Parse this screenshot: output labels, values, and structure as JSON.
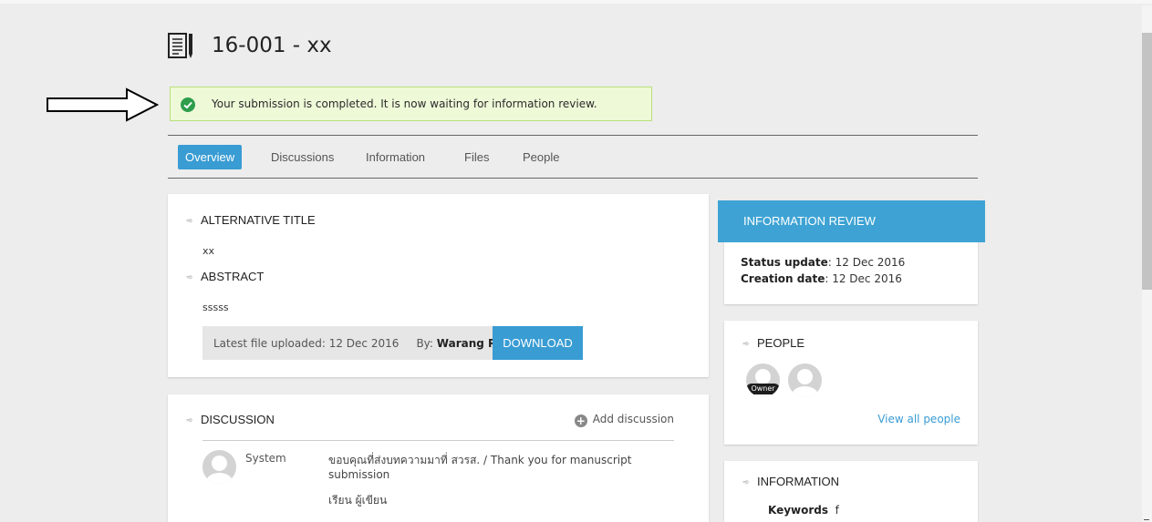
{
  "page": {
    "title": "16-001 - xx"
  },
  "alert": {
    "message": "Your submission is completed. It is now waiting for information review."
  },
  "tabs": [
    {
      "label": "Overview",
      "active": true
    },
    {
      "label": "Discussions",
      "active": false
    },
    {
      "label": "Information",
      "active": false
    },
    {
      "label": "Files",
      "active": false
    },
    {
      "label": "People",
      "active": false
    }
  ],
  "summary": {
    "alt_title_heading": "ALTERNATIVE TITLE",
    "alt_title_value": "xx",
    "abstract_heading": "ABSTRACT",
    "abstract_value": "sssss",
    "file_label": "Latest file uploaded: 12 Dec 2016",
    "by_label": "By:",
    "by_name": "Warang P.",
    "download_label": "DOWNLOAD"
  },
  "discussion": {
    "heading": "DISCUSSION",
    "add_label": "Add discussion",
    "items": [
      {
        "author": "System",
        "message": "ขอบคุณที่ส่งบทความมาที่ สวรส. / Thank you for manuscript",
        "message_cont": "submission",
        "greeting": "เรียน ผู้เขียน"
      }
    ]
  },
  "review": {
    "header": "INFORMATION REVIEW",
    "status_label": "Status update",
    "status_value": ": 12 Dec 2016",
    "creation_label": "Creation date",
    "creation_value": ": 12 Dec 2016"
  },
  "people": {
    "heading": "PEOPLE",
    "owner_badge": "Owner",
    "view_all": "View all people"
  },
  "information": {
    "heading": "INFORMATION",
    "keywords_label": "Keywords",
    "keywords_value": "f"
  },
  "colors": {
    "accent": "#399cd3",
    "alert_bg": "#eef9d8",
    "alert_border": "#b9e07a",
    "success": "#2e9e4c"
  },
  "icons": {
    "title": "document-icon",
    "alert": "check-circle-icon",
    "annotation": "right-arrow-icon",
    "bullet": "arrow-bullet-icon",
    "add": "plus-circle-icon",
    "avatar": "user-avatar-icon"
  }
}
